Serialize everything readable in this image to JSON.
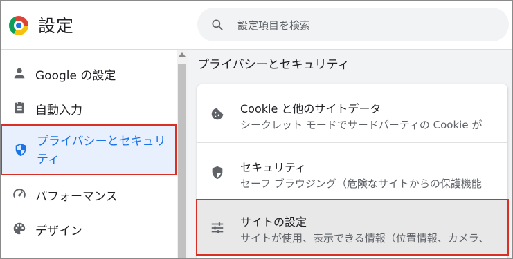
{
  "header": {
    "title": "設定",
    "search_placeholder": "設定項目を検索"
  },
  "sidebar": {
    "items": [
      {
        "label": "Google の設定",
        "icon": "person-icon"
      },
      {
        "label": "自動入力",
        "icon": "clipboard-icon"
      },
      {
        "label": "プライバシーとセキュリティ",
        "icon": "shield-icon",
        "active": true
      },
      {
        "label": "パフォーマンス",
        "icon": "speedometer-icon"
      },
      {
        "label": "デザイン",
        "icon": "palette-icon"
      }
    ]
  },
  "main": {
    "section_title": "プライバシーとセキュリティ",
    "rows": [
      {
        "title": "Cookie と他のサイトデータ",
        "subtitle": "シークレット モードでサードパーティの Cookie が",
        "icon": "cookie-icon"
      },
      {
        "title": "セキュリティ",
        "subtitle": "セーフ ブラウジング（危険なサイトからの保護機能",
        "icon": "shield-outline-icon"
      },
      {
        "title": "サイトの設定",
        "subtitle": "サイトが使用、表示できる情報（位置情報、カメラ、",
        "icon": "sliders-icon",
        "highlighted": true
      }
    ]
  },
  "colors": {
    "accent": "#1a73e8",
    "highlight_border": "#d93025",
    "active_bg": "#e8f0fe"
  }
}
